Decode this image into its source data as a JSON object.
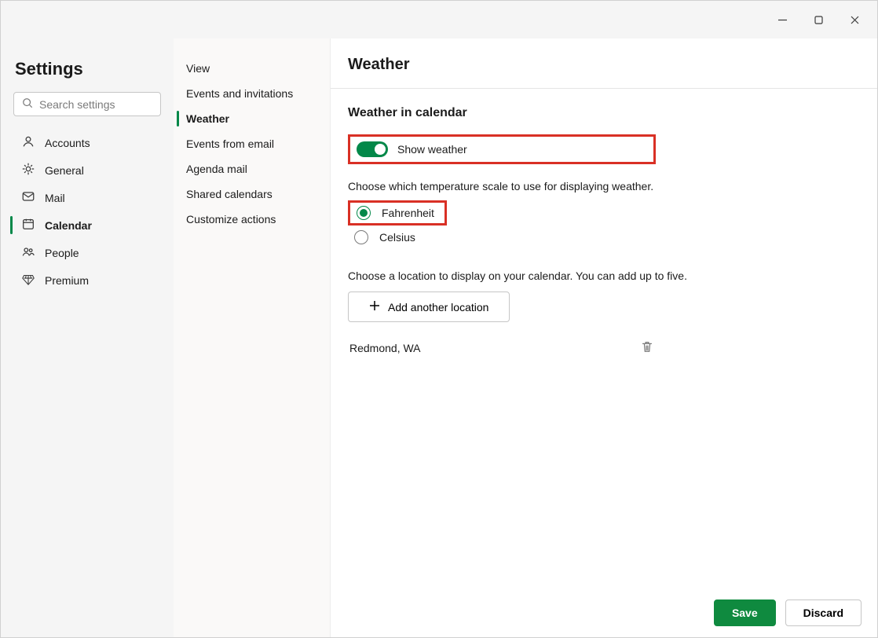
{
  "titlebar": {
    "minimize": "minimize",
    "maximize": "maximize",
    "close": "close"
  },
  "sidebar_l": {
    "title": "Settings",
    "search_placeholder": "Search settings",
    "items": [
      {
        "label": "Accounts",
        "active": false
      },
      {
        "label": "General",
        "active": false
      },
      {
        "label": "Mail",
        "active": false
      },
      {
        "label": "Calendar",
        "active": true
      },
      {
        "label": "People",
        "active": false
      },
      {
        "label": "Premium",
        "active": false
      }
    ]
  },
  "sidebar_m": {
    "items": [
      {
        "label": "View",
        "active": false
      },
      {
        "label": "Events and invitations",
        "active": false
      },
      {
        "label": "Weather",
        "active": true
      },
      {
        "label": "Events from email",
        "active": false
      },
      {
        "label": "Agenda mail",
        "active": false
      },
      {
        "label": "Shared calendars",
        "active": false
      },
      {
        "label": "Customize actions",
        "active": false
      }
    ]
  },
  "content": {
    "title": "Weather",
    "section_title": "Weather in calendar",
    "toggle_label": "Show weather",
    "scale_help": "Choose which temperature scale to use for displaying weather.",
    "scale_options": {
      "fahrenheit": "Fahrenheit",
      "celsius": "Celsius"
    },
    "location_help": "Choose a location to display on your calendar. You can add up to five.",
    "add_location_label": "Add another location",
    "locations": [
      "Redmond, WA"
    ]
  },
  "footer": {
    "save": "Save",
    "discard": "Discard"
  }
}
